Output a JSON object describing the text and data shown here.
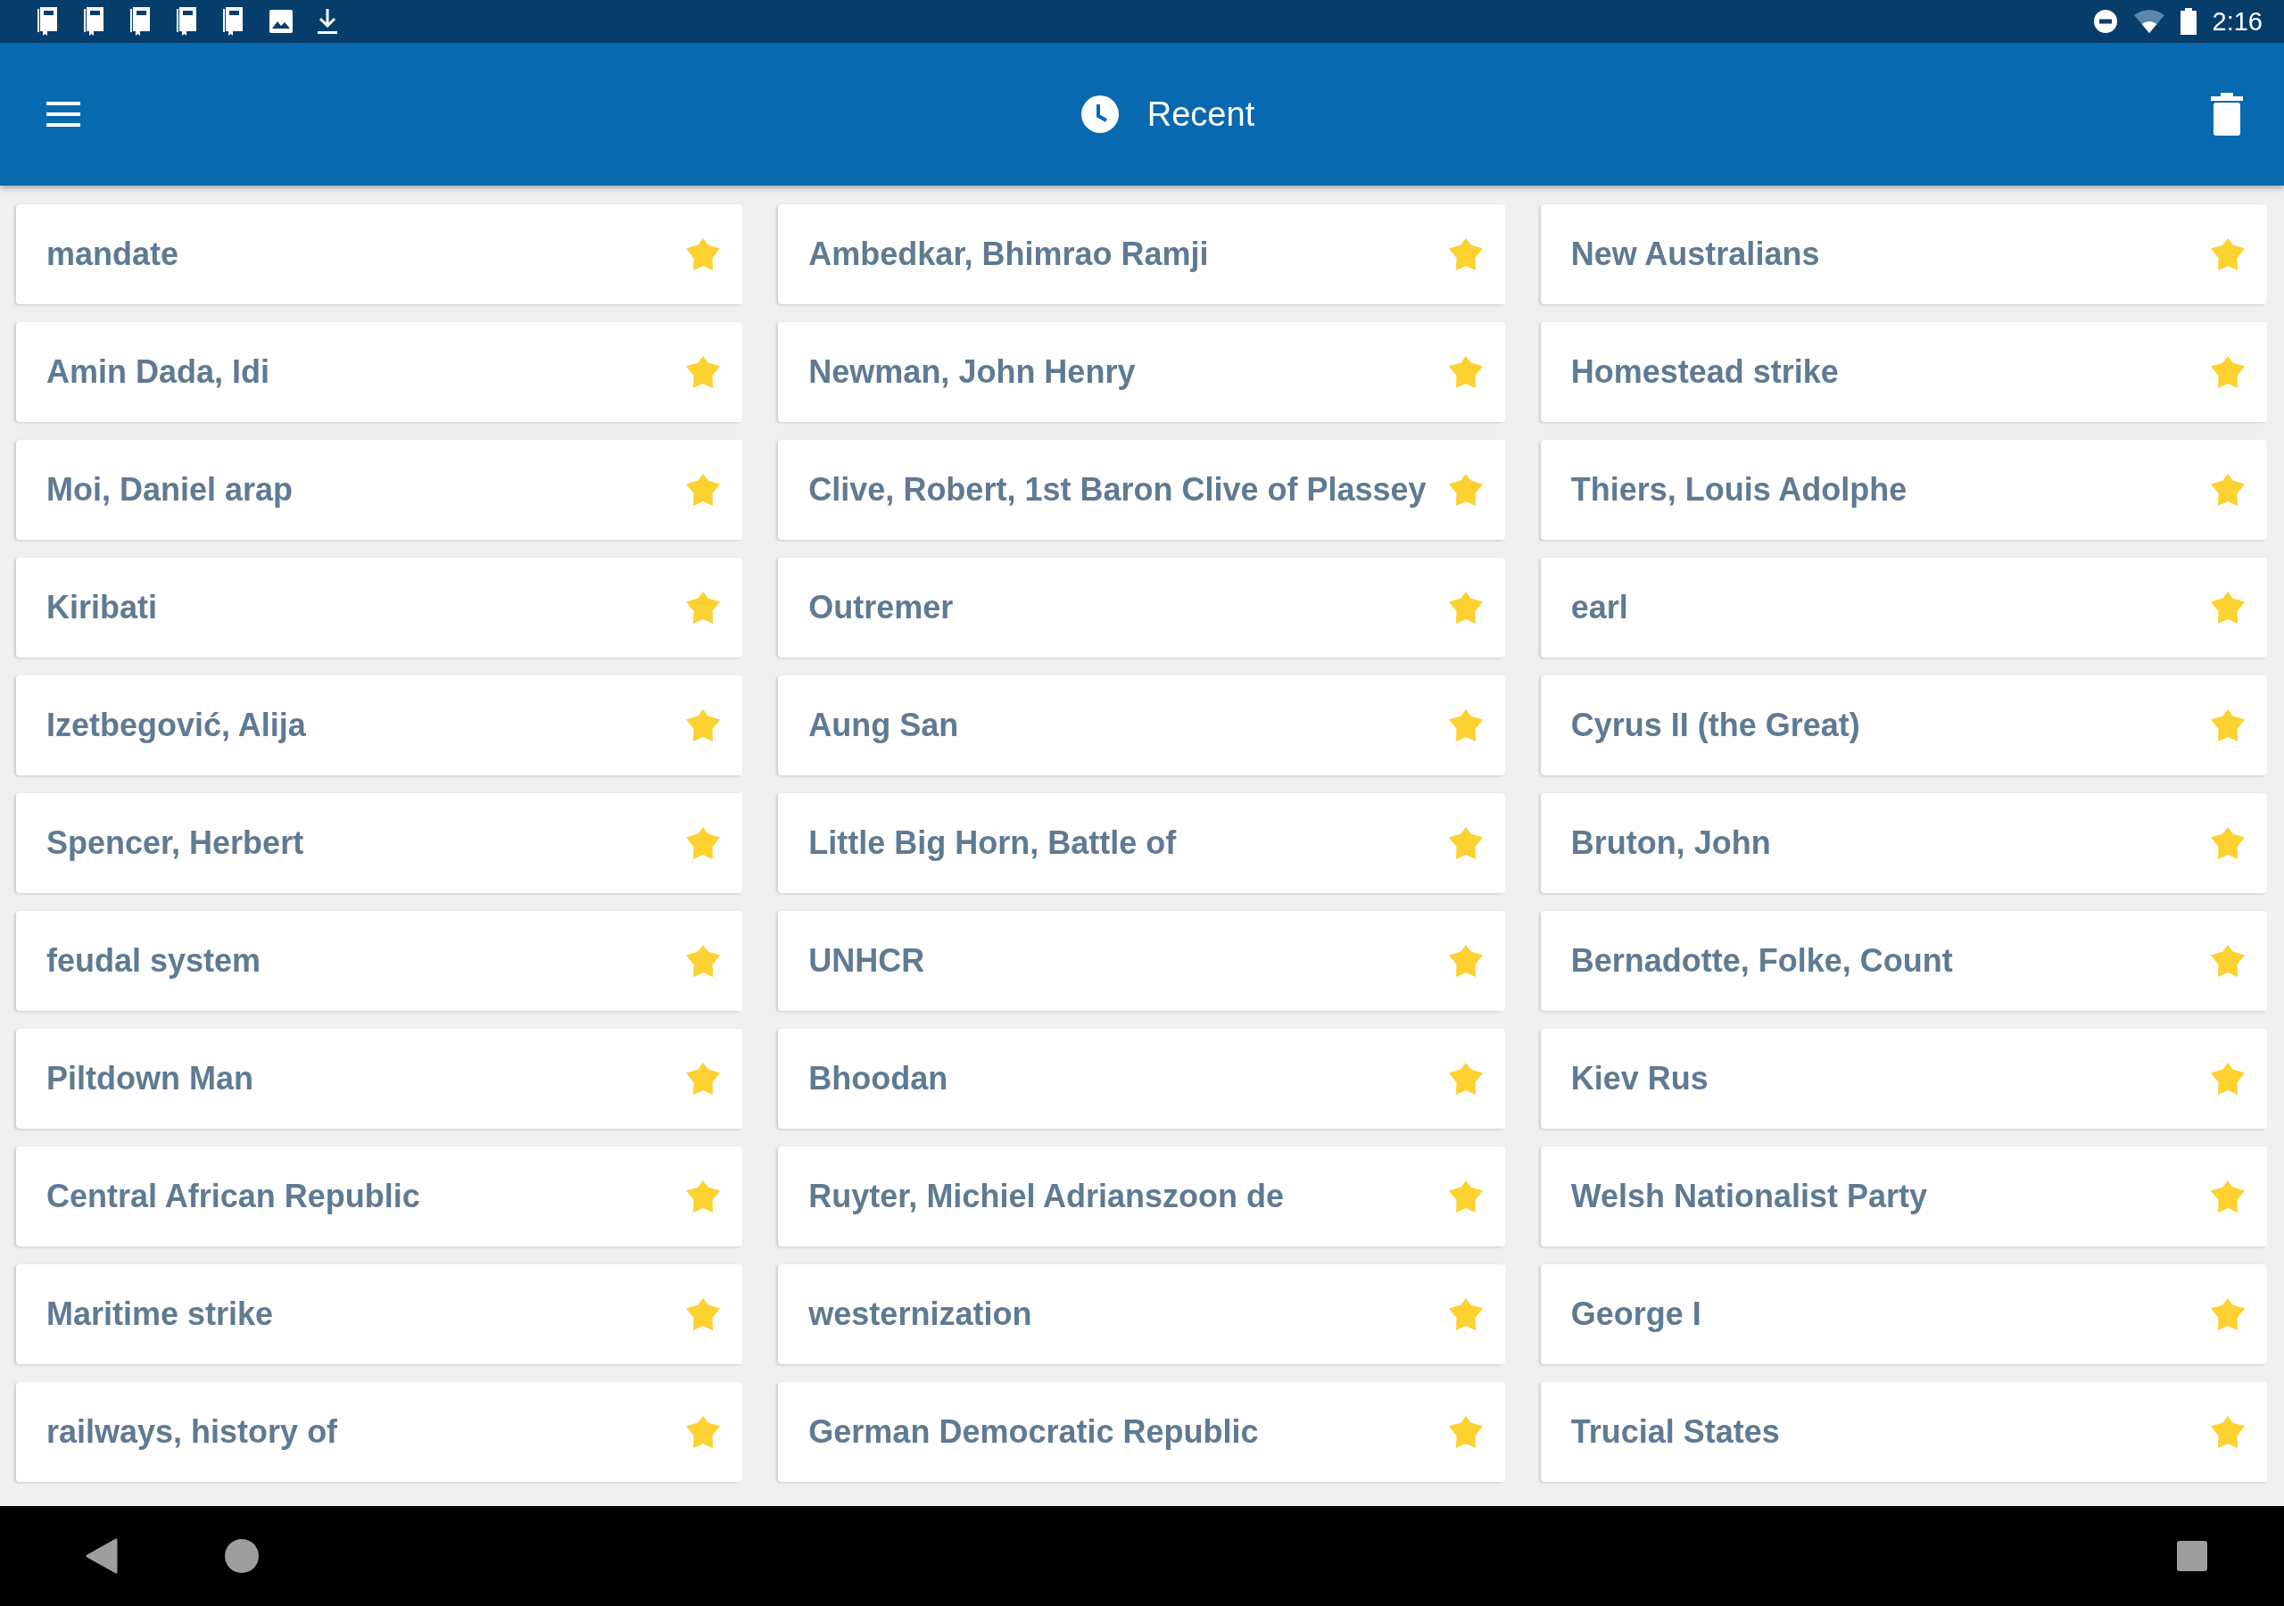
{
  "status_bar": {
    "notifications": [
      {
        "kind": "dictionary"
      },
      {
        "kind": "dictionary"
      },
      {
        "kind": "dictionary"
      },
      {
        "kind": "dictionary"
      },
      {
        "kind": "dictionary"
      },
      {
        "kind": "image"
      },
      {
        "kind": "download"
      }
    ],
    "time": "2:16"
  },
  "app_bar": {
    "title": "Recent"
  },
  "items": [
    {
      "label": "mandate",
      "starred": true
    },
    {
      "label": "Ambedkar, Bhimrao Ramji",
      "starred": true
    },
    {
      "label": "New Australians",
      "starred": true
    },
    {
      "label": "Amin Dada, Idi",
      "starred": true
    },
    {
      "label": "Newman, John Henry",
      "starred": true
    },
    {
      "label": "Homestead strike",
      "starred": true
    },
    {
      "label": "Moi, Daniel arap",
      "starred": true
    },
    {
      "label": "Clive, Robert, 1st Baron Clive of Plassey",
      "starred": true
    },
    {
      "label": "Thiers, Louis Adolphe",
      "starred": true
    },
    {
      "label": "Kiribati",
      "starred": true
    },
    {
      "label": "Outremer",
      "starred": true
    },
    {
      "label": "earl",
      "starred": true
    },
    {
      "label": "Izetbegović, Alija",
      "starred": true
    },
    {
      "label": "Aung San",
      "starred": true
    },
    {
      "label": "Cyrus II (the Great)",
      "starred": true
    },
    {
      "label": "Spencer, Herbert",
      "starred": true
    },
    {
      "label": "Little Big Horn, Battle of",
      "starred": true
    },
    {
      "label": "Bruton, John",
      "starred": true
    },
    {
      "label": "feudal system",
      "starred": true
    },
    {
      "label": "UNHCR",
      "starred": true
    },
    {
      "label": "Bernadotte, Folke, Count",
      "starred": true
    },
    {
      "label": "Piltdown Man",
      "starred": true
    },
    {
      "label": "Bhoodan",
      "starred": true
    },
    {
      "label": "Kiev Rus",
      "starred": true
    },
    {
      "label": "Central African Republic",
      "starred": true
    },
    {
      "label": "Ruyter, Michiel Adrianszoon de",
      "starred": true
    },
    {
      "label": "Welsh Nationalist Party",
      "starred": true
    },
    {
      "label": "Maritime strike",
      "starred": true
    },
    {
      "label": "westernization",
      "starred": true
    },
    {
      "label": "George I",
      "starred": true
    },
    {
      "label": "railways, history of",
      "starred": true
    },
    {
      "label": "German Democratic Republic",
      "starred": true
    },
    {
      "label": "Trucial States",
      "starred": true
    }
  ]
}
